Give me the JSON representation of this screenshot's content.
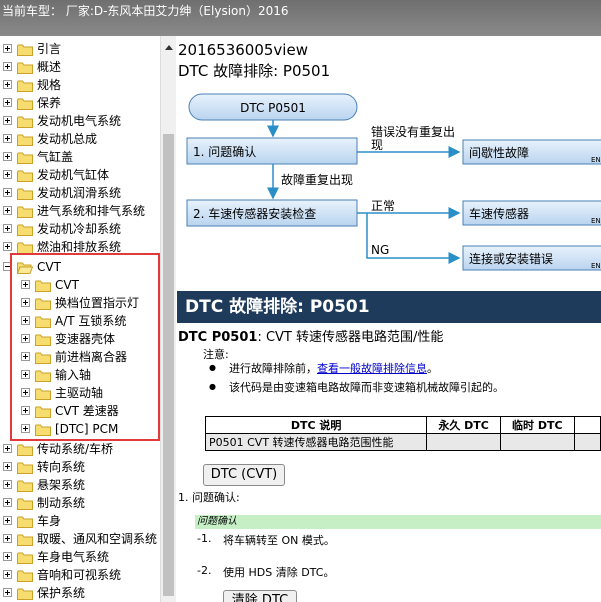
{
  "window": {
    "title": "当前车型： 厂家:D-东风本田艾力绅（Elysion）2016"
  },
  "tree": {
    "top_items": [
      "引言",
      "概述",
      "规格",
      "保养",
      "发动机电气系统",
      "发动机总成",
      "气缸盖",
      "发动机气缸体",
      "发动机润滑系统",
      "进气系统和排气系统",
      "发动机冷却系统",
      "燃油和排放系统"
    ],
    "open_item": "CVT",
    "children": [
      "CVT",
      "换档位置指示灯",
      "A/T 互锁系统",
      "变速器壳体",
      "前进档离合器",
      "输入轴",
      "主驱动轴",
      "CVT 差速器",
      "[DTC] PCM"
    ],
    "bottom_items": [
      "传动系统/车桥",
      "转向系统",
      "悬架系统",
      "制动系统",
      "车身",
      "取暖、通风和空调系统",
      "车身电气系统",
      "音响和可视系统",
      "保护系统"
    ]
  },
  "content": {
    "doc_id": "2016536005view",
    "heading": "DTC 故障排除: P0501",
    "flow": {
      "start": "DTC P0501",
      "step1": "1.  问题确认",
      "step1_note": "错误没有重复出",
      "step1_note2": "现",
      "step1_result": "间歇性故障",
      "arrow_label": "故障重复出现",
      "step2": "2.  车速传感器安装检查",
      "ok_label": "正常",
      "ok_result": "车速传感器",
      "ng_label": "NG",
      "ng_result": "连接或安装错误",
      "en_label": "EN"
    },
    "banner": "DTC 故障排除: P0501",
    "dtc_code": "DTC P0501",
    "dtc_desc": ": CVT 转速传感器电路范围/性能",
    "note_title": "注意:",
    "note1_pre": "进行故障排除前，",
    "note1_link": "查看一般故障排除信息",
    "note1_post": "。",
    "note2": "该代码是由变速箱电路故障而非变速箱机械故障引起的。",
    "table": {
      "headers": [
        "DTC 说明",
        "永久 DTC",
        "临时 DTC"
      ],
      "row": [
        "P0501 CVT 转速传感器电路范围性能",
        "",
        ""
      ]
    },
    "dtc_button": "DTC (CVT)",
    "section1": "1.   问题确认:",
    "sub_heading": "问题确认",
    "step_a_num": "-1.",
    "step_a": "将车辆转至 ON 模式。",
    "step_b_num": "-2.",
    "step_b": "使用 HDS 清除 DTC。",
    "clear_button": "清除 DTC"
  },
  "colors": {
    "highlight": "#e03a3a",
    "banner": "#1f3b5c",
    "flow_box": "#cfe3f7",
    "subhead": "#c6efc6",
    "link": "#0000cc"
  }
}
